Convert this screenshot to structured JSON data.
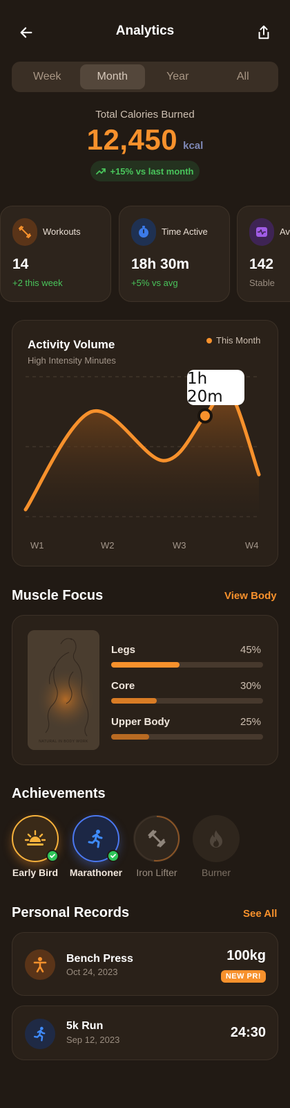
{
  "header": {
    "title": "Analytics",
    "back_icon": "arrow-left-icon",
    "share_icon": "share-icon"
  },
  "period_tabs": [
    {
      "label": "Week",
      "active": false
    },
    {
      "label": "Month",
      "active": true
    },
    {
      "label": "Year",
      "active": false
    },
    {
      "label": "All",
      "active": false
    }
  ],
  "summary": {
    "label": "Total Calories Burned",
    "value": "12,450",
    "unit": "kcal",
    "change": "+15% vs last month"
  },
  "stats": [
    {
      "label": "Workouts",
      "value": "14",
      "sub": "+2 this week",
      "icon": "dumbbell-icon",
      "sub_color": "#49c45b"
    },
    {
      "label": "Time Active",
      "value": "18h 30m",
      "sub": "+5% vs avg",
      "icon": "stopwatch-icon",
      "sub_color": "#49c45b"
    },
    {
      "label": "Avg HR",
      "value": "142",
      "sub": "Stable",
      "icon": "heart-pulse-icon",
      "sub_color": "#9a8d80"
    }
  ],
  "chart": {
    "title": "Activity Volume",
    "subtitle": "High Intensity Minutes",
    "legend": "This Month",
    "tooltip": "1h 20m",
    "accent": "#f7912c"
  },
  "chart_data": {
    "type": "area",
    "title": "Activity Volume",
    "subtitle": "High Intensity Minutes",
    "categories": [
      "W1",
      "W2",
      "W3",
      "W4"
    ],
    "series": [
      {
        "name": "This Month",
        "x": [
          1.0,
          2.1,
          3.3,
          4.0,
          4.4,
          4.9
        ],
        "values": [
          0.05,
          0.75,
          0.4,
          0.72,
          0.9,
          0.3
        ]
      }
    ],
    "highlight": {
      "label": "1h 20m"
    },
    "ylim": [
      0,
      1
    ],
    "grid": true
  },
  "muscle": {
    "title": "Muscle Focus",
    "link": "View Body",
    "map_caption": "NATURAL IN BODY WORK",
    "items": [
      {
        "label": "Legs",
        "pct_label": "45%",
        "value": 0.45,
        "color": "#f7912c"
      },
      {
        "label": "Core",
        "pct_label": "30%",
        "value": 0.3,
        "color": "#d97c25"
      },
      {
        "label": "Upper Body",
        "pct_label": "25%",
        "value": 0.25,
        "color": "#b86a22"
      }
    ]
  },
  "achievements": {
    "title": "Achievements",
    "items": [
      {
        "label": "Early Bird",
        "icon": "sunrise-icon",
        "earned": true
      },
      {
        "label": "Marathoner",
        "icon": "runner-icon",
        "earned": true
      },
      {
        "label": "Iron Lifter",
        "icon": "dumbbell-icon",
        "earned": false
      },
      {
        "label": "Burner",
        "icon": "flame-icon",
        "earned": false
      }
    ]
  },
  "records": {
    "title": "Personal Records",
    "link": "See All",
    "items": [
      {
        "name": "Bench Press",
        "date": "Oct 24, 2023",
        "value": "100kg",
        "badge": "NEW PR!",
        "icon": "person-icon"
      },
      {
        "name": "5k Run",
        "date": "Sep 12, 2023",
        "value": "24:30",
        "icon": "runner-icon"
      }
    ]
  }
}
